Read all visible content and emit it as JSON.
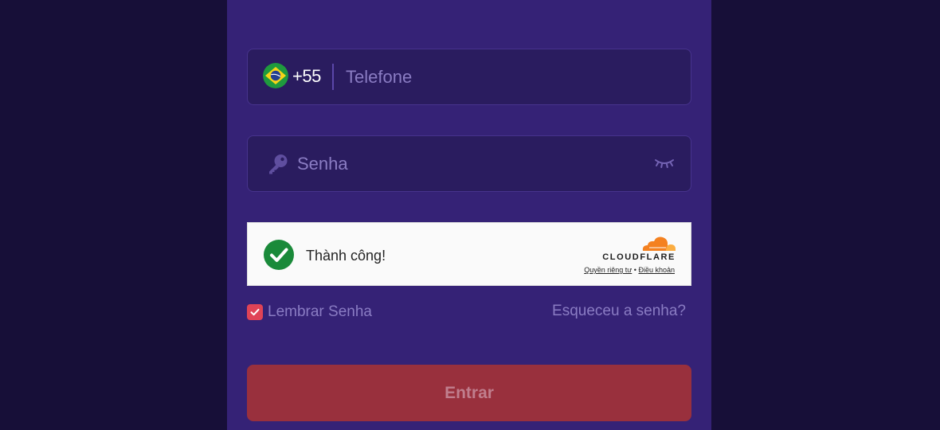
{
  "login_form": {
    "phone": {
      "country_flag": "brazil-flag",
      "dial_code": "+55",
      "placeholder": "Telefone",
      "value": ""
    },
    "password": {
      "placeholder": "Senha",
      "value": ""
    },
    "captcha": {
      "status_text": "Thành công!",
      "provider": "CLOUDFLARE",
      "privacy_link": "Quyền riêng tư",
      "separator": "•",
      "terms_link": "Điều khoản",
      "success_color": "#1a8a3a"
    },
    "remember": {
      "label": "Lembrar Senha",
      "checked": true
    },
    "forgot_link": "Esqueceu a senha?",
    "submit_label": "Entrar"
  },
  "colors": {
    "page_background": "#170f38",
    "panel_background": "#352276",
    "field_background": "#2a1c5f",
    "accent_red": "#e04356",
    "button_background": "#99303d",
    "muted_text": "#8a7cc3"
  }
}
